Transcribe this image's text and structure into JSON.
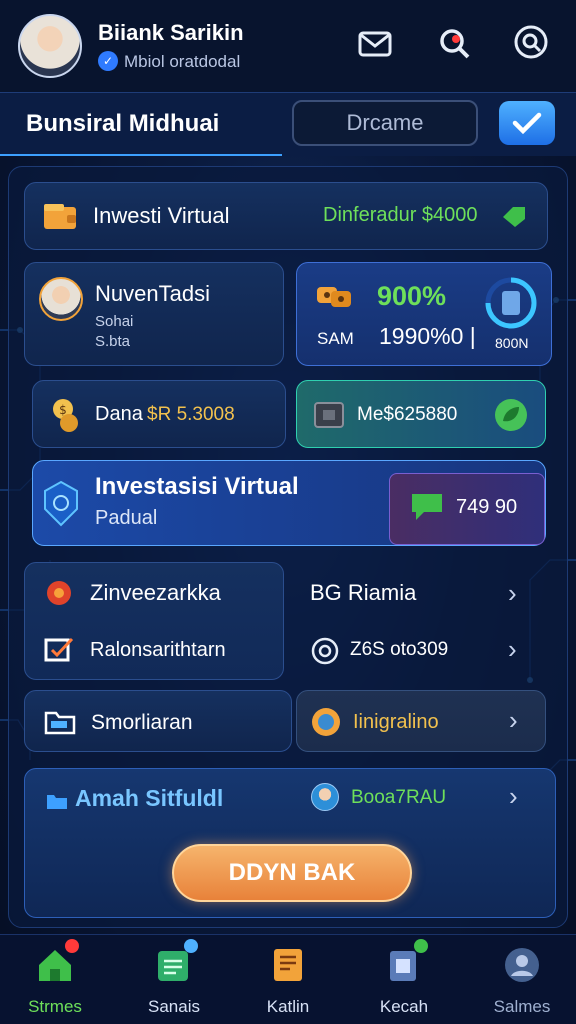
{
  "header": {
    "user_name": "Biiank Sarikin",
    "user_sub": "Mbiol oratdodal"
  },
  "titlebar": {
    "title": "Bunsiral Midhuai",
    "search_placeholder": "Drcame"
  },
  "invest_bar": {
    "label": "Inwesti Virtual",
    "value": "Dinferadur $4000"
  },
  "profile_card": {
    "name": "NuvenTadsi",
    "line1": "Sohai",
    "line2": "S.bta"
  },
  "stats_card": {
    "percent": "900%",
    "label": "SAM",
    "value": "1990%0 |",
    "ring_label": "800N"
  },
  "dana_card": {
    "label": "Dana",
    "value": "$R 5.3008"
  },
  "mes_card": {
    "value": "Me$625880"
  },
  "feature_card": {
    "title": "Investasisi Virtual",
    "subtitle": "Padual",
    "chat_value": "749 90"
  },
  "menu": {
    "item1": "Zinveezarkka",
    "item2": "BG Riamia",
    "item3": "Ralonsarithtarn",
    "item4": "Z6S oto309",
    "item5": "Smorliaran",
    "item6": "Iinigralino"
  },
  "amah_card": {
    "label": "Amah Sitfuldl",
    "value": "Booa7RAU"
  },
  "cta": {
    "label": "DDYN BAK"
  },
  "nav": {
    "item1": "Strmes",
    "item2": "Sanais",
    "item3": "Katlin",
    "item4": "Kecah",
    "item5": "Salmes"
  },
  "colors": {
    "accent_blue": "#3da0ff",
    "green_value": "#6ee05a",
    "gold_value": "#f2c14e",
    "cta_orange": "#f3a25a"
  }
}
